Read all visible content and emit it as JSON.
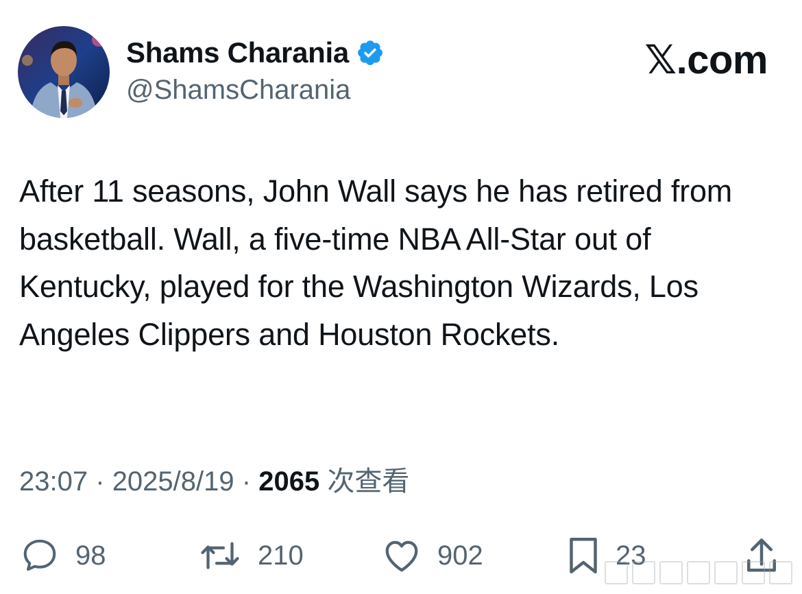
{
  "author": {
    "display_name": "Shams Charania",
    "handle": "@ShamsCharania",
    "verified": true,
    "avatar_icon": "profile-photo"
  },
  "brand": {
    "label": "𝕏.com"
  },
  "tweet": {
    "text": "After 11 seasons, John Wall says he has retired from basketball. Wall, a five-time NBA All-Star out of Kentucky, played for the Washington Wizards, Los Angeles Clippers and Houston Rockets."
  },
  "meta": {
    "time": "23:07",
    "separator": "·",
    "date": "2025/8/19",
    "views_count": "2065",
    "views_label": "次查看"
  },
  "actions": {
    "reply": {
      "icon": "reply-icon",
      "count": "98"
    },
    "retweet": {
      "icon": "retweet-icon",
      "count": "210"
    },
    "like": {
      "icon": "heart-icon",
      "count": "902"
    },
    "bookmark": {
      "icon": "bookmark-icon",
      "count": "23"
    },
    "share": {
      "icon": "share-icon"
    }
  },
  "colors": {
    "primary_text": "#0f1419",
    "secondary_text": "#536471",
    "verified_blue": "#1d9bf0"
  }
}
